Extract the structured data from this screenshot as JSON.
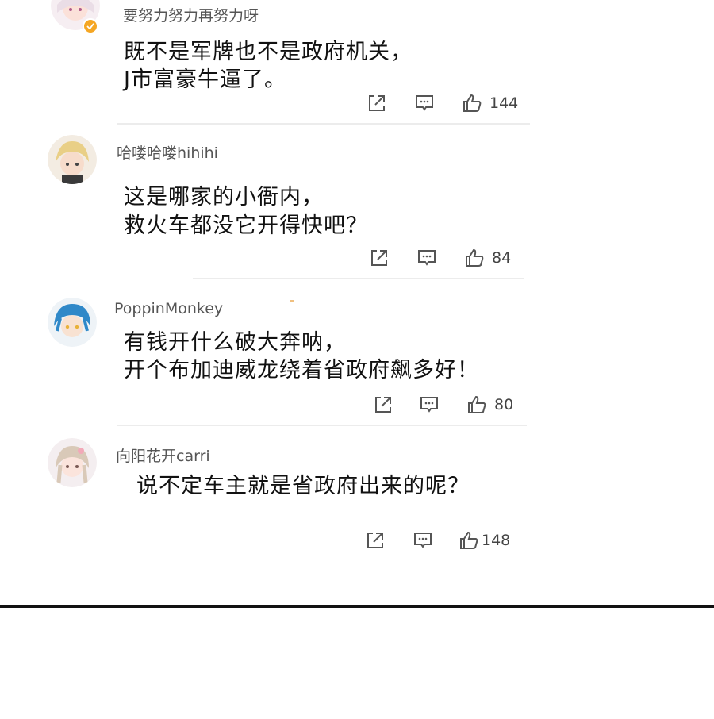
{
  "comments": [
    {
      "username": "要努力努力再努力呀",
      "verified": true,
      "lines": [
        "既不是军牌也不是政府机关，",
        "J市富豪牛逼了。"
      ],
      "likes": "144",
      "avatar": "avatar-pink-hair-girl"
    },
    {
      "username": "哈喽哈喽hihihi",
      "verified": false,
      "lines": [
        "这是哪家的小衙内，",
        "救火车都没它开得快吧？"
      ],
      "likes": "84",
      "avatar": "avatar-blonde-boy"
    },
    {
      "username": "PoppinMonkey",
      "verified": false,
      "lines": [
        "有钱开什么破大奔呐，",
        "开个布加迪威龙绕着省政府飙多好！"
      ],
      "likes": "80",
      "avatar": "avatar-blue-hair-boy"
    },
    {
      "username": "向阳花开carri",
      "verified": false,
      "lines": [
        "说不定车主就是省政府出来的呢？"
      ],
      "likes": "148",
      "avatar": "avatar-light-hair-girl"
    }
  ],
  "icons": {
    "share": "share-icon",
    "reply": "comment-icon",
    "like": "thumbs-up-icon"
  },
  "colors": {
    "verified_badge": "#f5a623",
    "divider": "#ececec",
    "bottom_bar": "#111111"
  }
}
